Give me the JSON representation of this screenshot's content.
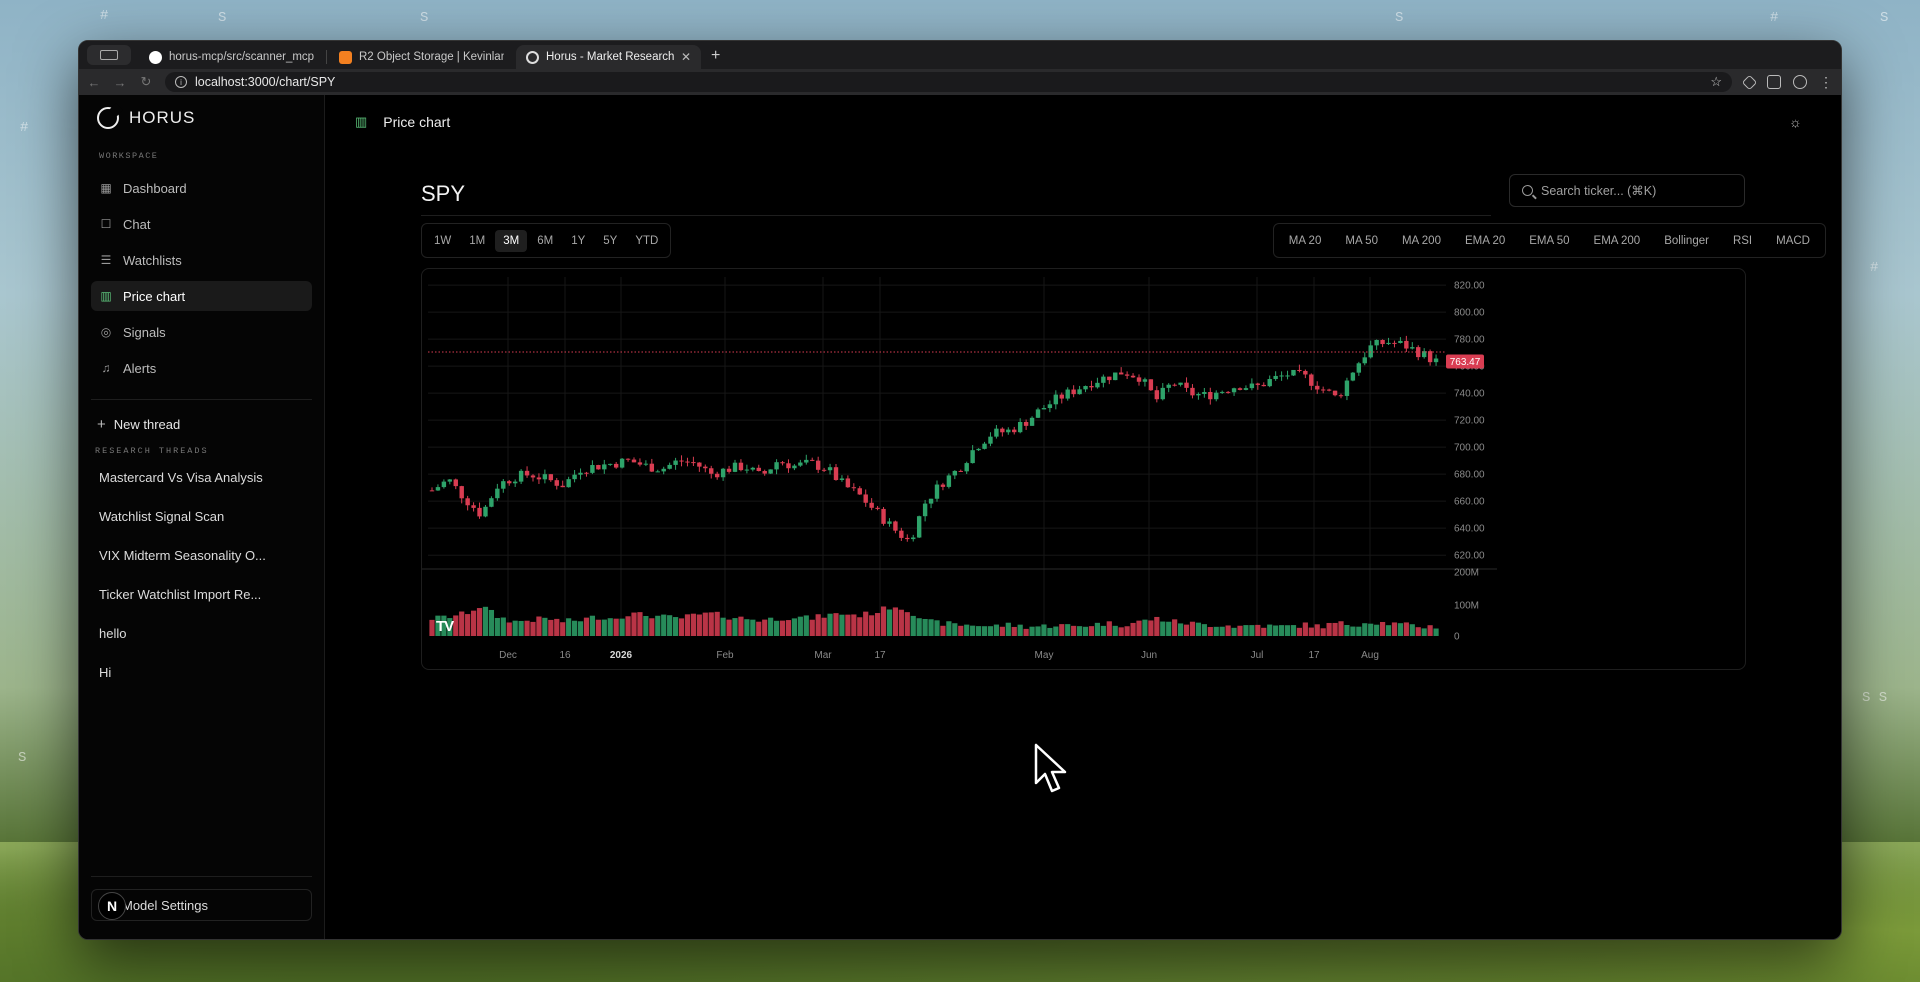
{
  "browser": {
    "tabs": [
      {
        "title": "horus-mcp/src/scanner_mcp",
        "icon": "github-icon",
        "active": false
      },
      {
        "title": "R2 Object Storage | Kevinlan",
        "icon": "cloudflare-icon",
        "active": false
      },
      {
        "title": "Horus - Market Research",
        "icon": "horus-icon",
        "active": true
      }
    ],
    "url": "localhost:3000/chart/SPY"
  },
  "sidebar": {
    "logo_text": "HORUS",
    "workspace_label": "WORKSPACE",
    "nav": [
      {
        "label": "Dashboard",
        "icon": "dashboard-icon",
        "glyph": "▦",
        "active": false
      },
      {
        "label": "Chat",
        "icon": "chat-icon",
        "glyph": "☐",
        "active": false
      },
      {
        "label": "Watchlists",
        "icon": "watchlist-icon",
        "glyph": "☰",
        "active": false
      },
      {
        "label": "Price chart",
        "icon": "price-chart-icon",
        "glyph": "▥",
        "active": true
      },
      {
        "label": "Signals",
        "icon": "signals-icon",
        "glyph": "◎",
        "active": false
      },
      {
        "label": "Alerts",
        "icon": "bell-icon",
        "glyph": "♫",
        "active": false
      }
    ],
    "new_thread": "New thread",
    "threads_label": "RESEARCH THREADS",
    "threads": [
      "Mastercard Vs Visa Analysis",
      "Watchlist Signal Scan",
      "VIX Midterm Seasonality O...",
      "Ticker Watchlist Import Re...",
      "hello",
      "Hi"
    ],
    "model_settings": "Model Settings",
    "avatar_letter": "N"
  },
  "main": {
    "header_title": "Price chart",
    "ticker": "SPY",
    "search_placeholder": "Search ticker... (⌘K)",
    "ranges": [
      {
        "label": "1W",
        "active": false
      },
      {
        "label": "1M",
        "active": false
      },
      {
        "label": "3M",
        "active": true
      },
      {
        "label": "6M",
        "active": false
      },
      {
        "label": "1Y",
        "active": false
      },
      {
        "label": "5Y",
        "active": false
      },
      {
        "label": "YTD",
        "active": false
      }
    ],
    "indicators": [
      "MA 20",
      "MA 50",
      "MA 200",
      "EMA 20",
      "EMA 50",
      "EMA 200",
      "Bollinger",
      "RSI",
      "MACD"
    ]
  },
  "chart_data": {
    "type": "candlestick",
    "symbol": "SPY",
    "last_price": "763.47",
    "price_axis_ticks": [
      "820.00",
      "800.00",
      "780.00",
      "760.00",
      "740.00",
      "720.00",
      "700.00",
      "680.00",
      "660.00",
      "640.00",
      "620.00"
    ],
    "ylim": [
      612,
      826
    ],
    "volume_axis_ticks": [
      "200M",
      "100M",
      "0"
    ],
    "volume_ylim": [
      0,
      200
    ],
    "x_tick_labels": [
      "Dec",
      "16",
      "2026",
      "Feb",
      "Mar",
      "17",
      "May",
      "Jun",
      "Jul",
      "17",
      "Aug"
    ],
    "bold_x_labels": [
      "2026"
    ],
    "up_color": "#2ea36a",
    "down_color": "#d93d52",
    "close_path": [
      668,
      676,
      662,
      650,
      672,
      678,
      680,
      676,
      672,
      684,
      686,
      688,
      690,
      686,
      684,
      690,
      688,
      680,
      684,
      686,
      678,
      690,
      686,
      688,
      684,
      672,
      664,
      652,
      640,
      630,
      660,
      674,
      684,
      700,
      710,
      712,
      718,
      728,
      736,
      742,
      748,
      752,
      756,
      752,
      735,
      748,
      740,
      738,
      742,
      746,
      744,
      750,
      754,
      752,
      744,
      736,
      758,
      774,
      778,
      776,
      770,
      763.47
    ],
    "volume_pattern": [
      55,
      60,
      70,
      95,
      60,
      45,
      50,
      55,
      45,
      50,
      60,
      55,
      70,
      65,
      60,
      55,
      65,
      70,
      60,
      55,
      50,
      55,
      60,
      55,
      65,
      70,
      65,
      75,
      95,
      80,
      45,
      40,
      35,
      35,
      30,
      35,
      30,
      30,
      35,
      30,
      35,
      40,
      35,
      45,
      55,
      45,
      40,
      35,
      35,
      30,
      35,
      30,
      30,
      35,
      30,
      40,
      35,
      45,
      40,
      35,
      30,
      30
    ]
  }
}
